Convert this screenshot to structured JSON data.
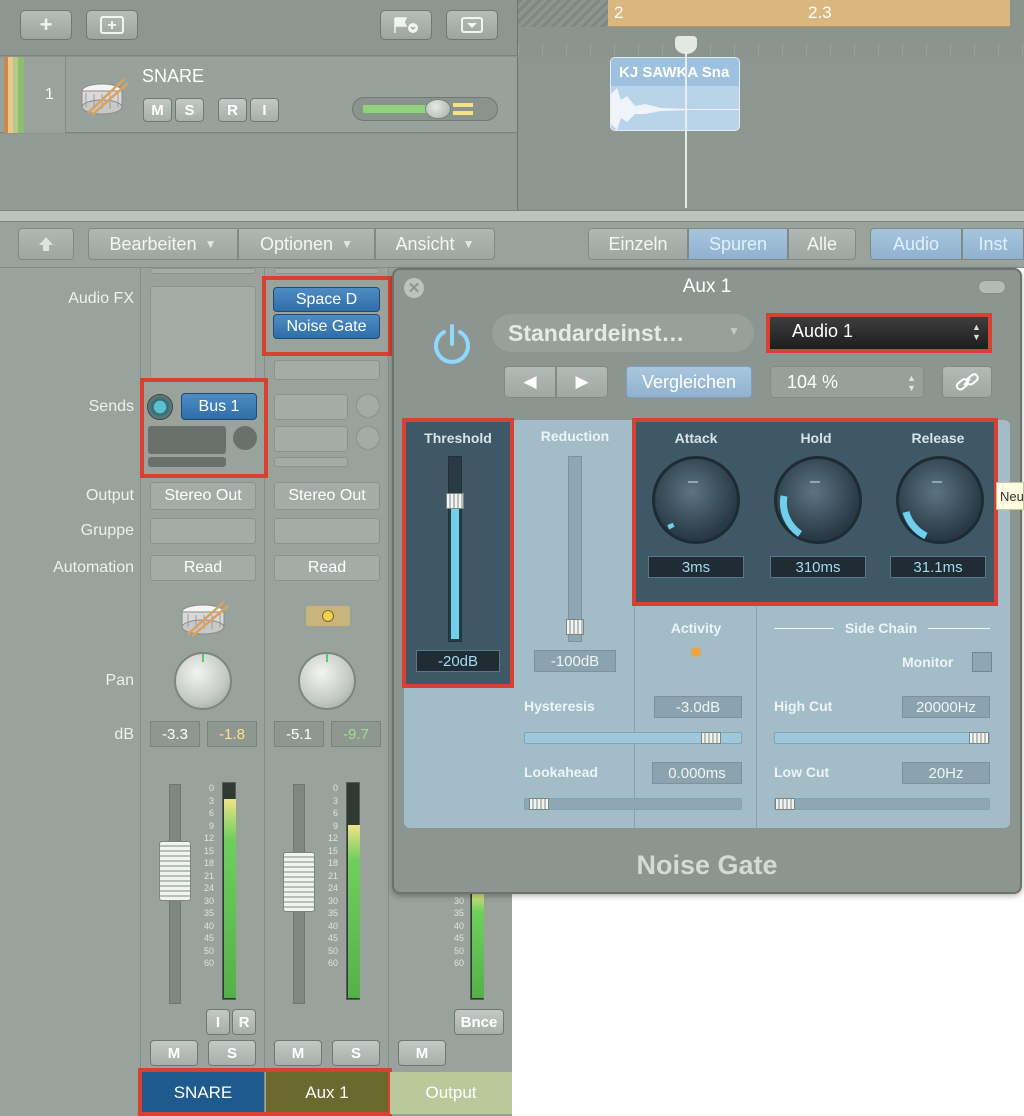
{
  "tracks": {
    "add_track_icon": "plus-icon",
    "ruler": {
      "bar_2": "2",
      "bar_2_3": "2.3"
    },
    "track": {
      "number": "1",
      "name": "SNARE",
      "buttons": [
        "M",
        "S",
        "R",
        "I"
      ]
    },
    "region": {
      "title": "KJ SAWKA Sna"
    }
  },
  "toolbar": {
    "menus": [
      "Bearbeiten",
      "Optionen",
      "Ansicht"
    ],
    "view_buttons": [
      "Einzeln",
      "Spuren",
      "Alle"
    ],
    "type_buttons": [
      "Audio",
      "Inst"
    ],
    "selected_view": "Spuren"
  },
  "mixer": {
    "row_labels": {
      "audio_fx": "Audio FX",
      "sends": "Sends",
      "output": "Output",
      "gruppe": "Gruppe",
      "automation": "Automation",
      "pan": "Pan",
      "db": "dB"
    },
    "strips": [
      {
        "name": "SNARE",
        "send": "Bus 1",
        "output": "Stereo Out",
        "automation": "Read",
        "db_volume": "-3.3",
        "db_peak": "-1.8",
        "mute": "M",
        "solo": "S",
        "extra_buttons": [
          "I",
          "R"
        ],
        "meter_level": 0.92
      },
      {
        "name": "Aux 1",
        "plugins": [
          "Space D",
          "Noise Gate"
        ],
        "output": "Stereo Out",
        "automation": "Read",
        "db_volume": "-5.1",
        "db_peak": "-9.7",
        "mute": "M",
        "solo": "S",
        "meter_level": 0.8
      },
      {
        "name": "Output",
        "mute": "M",
        "bounce": "Bnce",
        "meter_level": 0.5
      }
    ],
    "meter_scale": [
      "0",
      "3",
      "6",
      "9",
      "12",
      "15",
      "18",
      "21",
      "24",
      "30",
      "35",
      "40",
      "45",
      "50",
      "60"
    ]
  },
  "plugin": {
    "window_title": "Aux 1",
    "preset": "Standardeinst…",
    "side_chain_source": "Audio 1",
    "compare": "Vergleichen",
    "zoom": "104 %",
    "plugin_name": "Noise Gate",
    "threshold": {
      "label": "Threshold",
      "value": "-20dB",
      "fraction": 0.72
    },
    "reduction": {
      "label": "Reduction",
      "value": "-100dB",
      "fraction": 0.05
    },
    "attack": {
      "label": "Attack",
      "value": "3ms"
    },
    "hold": {
      "label": "Hold",
      "value": "310ms"
    },
    "release": {
      "label": "Release",
      "value": "31.1ms"
    },
    "activity": "Activity",
    "side_chain": "Side Chain",
    "monitor": "Monitor",
    "hysteresis": {
      "label": "Hysteresis",
      "value": "-3.0dB",
      "fraction": 0.9
    },
    "lookahead": {
      "label": "Lookahead",
      "value": "0.000ms",
      "fraction": 0.02
    },
    "high_cut": {
      "label": "High Cut",
      "value": "20000Hz",
      "fraction": 1.0
    },
    "low_cut": {
      "label": "Low Cut",
      "value": "20Hz",
      "fraction": 0.0
    },
    "tooltip": "Neu"
  }
}
